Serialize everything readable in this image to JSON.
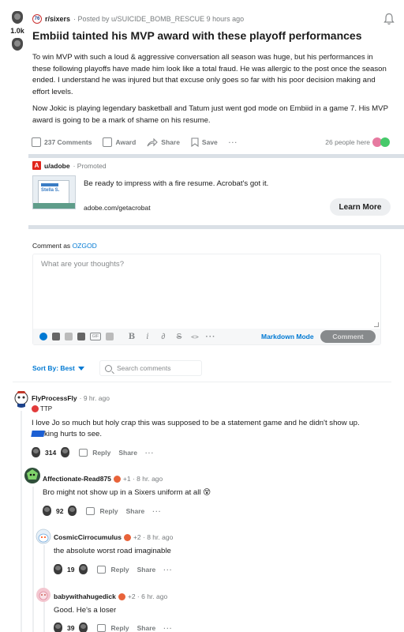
{
  "post": {
    "votes": "1.0k",
    "subreddit": "r/sixers",
    "subreddit_icon_text": "76",
    "posted_by": "· Posted by u/SUICIDE_BOMB_RESCUE 9 hours ago",
    "title": "Embiid tainted his MVP award with these playoff performances",
    "body_p1": "To win MVP with such a loud & aggressive conversation all season was huge, but his performances in these following playoffs have made him look like a total fraud. He was allergic to the post once the season ended. I understand he was injured but that excuse only goes so far with his poor decision making and effort levels.",
    "body_p2": "Now Jokic is playing legendary basketball and Tatum just went god mode on Embiid in a game 7. His MVP award is going to be a mark of shame on his resume.",
    "actions": {
      "comments": "237 Comments",
      "award": "Award",
      "share": "Share",
      "save": "Save",
      "more": "···",
      "here": "26 people here"
    }
  },
  "promo": {
    "user": "u/adobe",
    "promoted": "· Promoted",
    "logo_text": "A",
    "thumb_text": "Stella S.",
    "text": "Be ready to impress with a fire resume. Acrobat's got it.",
    "link": "adobe.com/getacrobat",
    "cta": "Learn More"
  },
  "composer": {
    "comment_as": "Comment as",
    "username": "OZGOD",
    "placeholder": "What are your thoughts?",
    "gif": "GIF",
    "bold": "B",
    "italic": "i",
    "link": "∂",
    "strike": "S",
    "code": "<>",
    "more": "···",
    "markdown": "Markdown Mode",
    "submit": "Comment"
  },
  "sort": {
    "label": "Sort By: Best",
    "search_placeholder": "Search comments"
  },
  "comments": [
    {
      "author": "FlyProcessFly",
      "meta": "· 9 hr. ago",
      "flair": "TTP",
      "body_line1": "I love Jo so much but holy crap this was supposed to be a statement game and he didn't show up.",
      "body_line2_suffix": "king hurts to see.",
      "score": "314",
      "reply": "Reply",
      "share": "Share",
      "more": "···"
    },
    {
      "author": "Affectionate-Read875",
      "meta": "+1 · 8 hr. ago",
      "body": "Bro might not show up in a Sixers uniform at all 😵",
      "score": "92",
      "reply": "Reply",
      "share": "Share",
      "more": "···"
    },
    {
      "author": "CosmicCirrocumulus",
      "meta": "+2 · 8 hr. ago",
      "body": "the absolute worst road imaginable",
      "score": "19",
      "reply": "Reply",
      "share": "Share",
      "more": "···"
    },
    {
      "author": "babywithahugedick",
      "meta": "+2 · 6 hr. ago",
      "body": "Good. He's a loser",
      "score": "39",
      "reply": "Reply",
      "share": "Share",
      "more": "···"
    }
  ],
  "colors": {
    "accent": "#0079d3",
    "muted": "#787c7e",
    "divider": "#dae0e6"
  }
}
